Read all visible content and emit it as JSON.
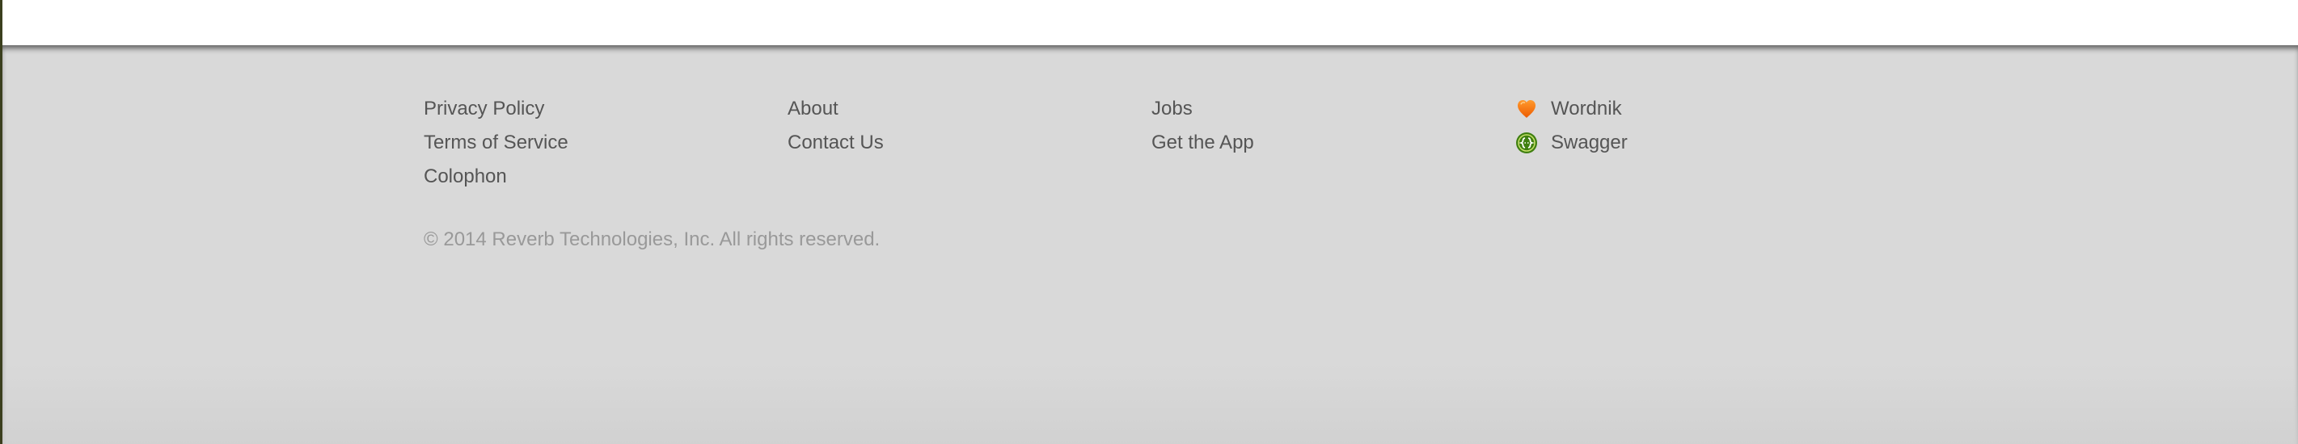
{
  "footer": {
    "columns": [
      {
        "links": [
          "Privacy Policy",
          "Terms of Service",
          "Colophon"
        ]
      },
      {
        "links": [
          "About",
          "Contact Us"
        ]
      },
      {
        "links": [
          "Jobs",
          "Get the App"
        ]
      },
      {
        "brands": [
          {
            "label": "Wordnik",
            "icon": "heart-icon",
            "color": "#f26a0f"
          },
          {
            "label": "Swagger",
            "icon": "swagger-logo-icon",
            "color": "#3f7f10"
          }
        ]
      }
    ],
    "copyright": "© 2014 Reverb Technologies, Inc. All rights reserved."
  }
}
